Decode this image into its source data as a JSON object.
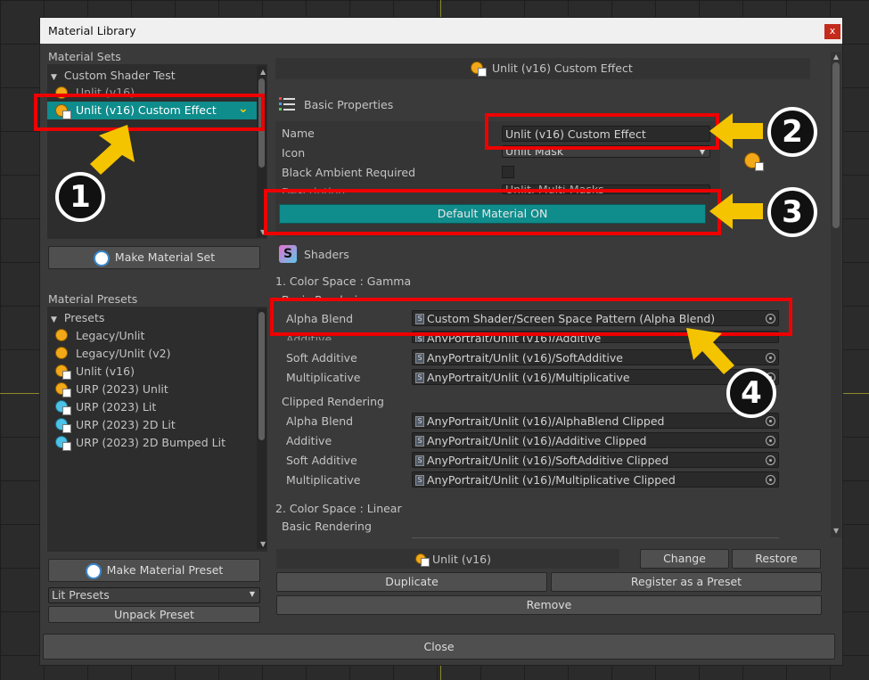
{
  "window": {
    "title": "Material Library",
    "close_glyph": "x"
  },
  "sets": {
    "heading": "Material Sets",
    "group": "Custom Shader Test",
    "items": [
      "Unlit (v16)",
      "Unlit (v16) Custom Effect"
    ],
    "make_button": "Make Material Set"
  },
  "presets": {
    "heading": "Material Presets",
    "group": "Presets",
    "items": [
      "Legacy/Unlit",
      "Legacy/Unlit (v2)",
      "Unlit (v16)",
      "URP (2023) Unlit",
      "URP (2023) Lit",
      "URP (2023) 2D Lit",
      "URP (2023) 2D Bumped Lit"
    ],
    "make_button": "Make Material Preset",
    "filter_select": "Lit Presets",
    "unpack_button": "Unpack Preset"
  },
  "detail": {
    "header": "Unlit (v16) Custom Effect",
    "basic_heading": "Basic Properties",
    "name_label": "Name",
    "name_value": "Unlit (v16) Custom Effect",
    "icon_label": "Icon",
    "icon_value": "Unlit Mask",
    "black_ambient_label": "Black Ambient Required",
    "description_label": "Description",
    "description_value": "Unlit, Multi-Masks",
    "default_button": "Default Material ON",
    "shaders_heading": "Shaders",
    "gamma_heading": "1. Color Space : Gamma",
    "basic_rendering": "Basic Rendering",
    "clipped_rendering": "Clipped Rendering",
    "linear_heading": "2. Color Space : Linear",
    "basic_rows": [
      {
        "label": "Alpha Blend",
        "path": "Custom Shader/Screen Space Pattern (Alpha Blend)"
      },
      {
        "label": "Additive",
        "path": "AnyPortrait/Unlit (v16)/Additive"
      },
      {
        "label": "Soft Additive",
        "path": "AnyPortrait/Unlit (v16)/SoftAdditive"
      },
      {
        "label": "Multiplicative",
        "path": "AnyPortrait/Unlit (v16)/Multiplicative"
      }
    ],
    "clipped_rows": [
      {
        "label": "Alpha Blend",
        "path": "AnyPortrait/Unlit (v16)/AlphaBlend Clipped"
      },
      {
        "label": "Additive",
        "path": "AnyPortrait/Unlit (v16)/Additive Clipped"
      },
      {
        "label": "Soft Additive",
        "path": "AnyPortrait/Unlit (v16)/SoftAdditive Clipped"
      },
      {
        "label": "Multiplicative",
        "path": "AnyPortrait/Unlit (v16)/Multiplicative Clipped"
      }
    ]
  },
  "footer": {
    "base_label": "Unlit (v16)",
    "change": "Change",
    "restore": "Restore",
    "duplicate": "Duplicate",
    "register": "Register as a Preset",
    "remove": "Remove",
    "close": "Close"
  },
  "callouts": [
    "1",
    "2",
    "3",
    "4"
  ],
  "colors": {
    "accent_teal": "#0f8c8c",
    "annotation_red": "#ee0000",
    "arrow_yellow": "#f5c400"
  }
}
